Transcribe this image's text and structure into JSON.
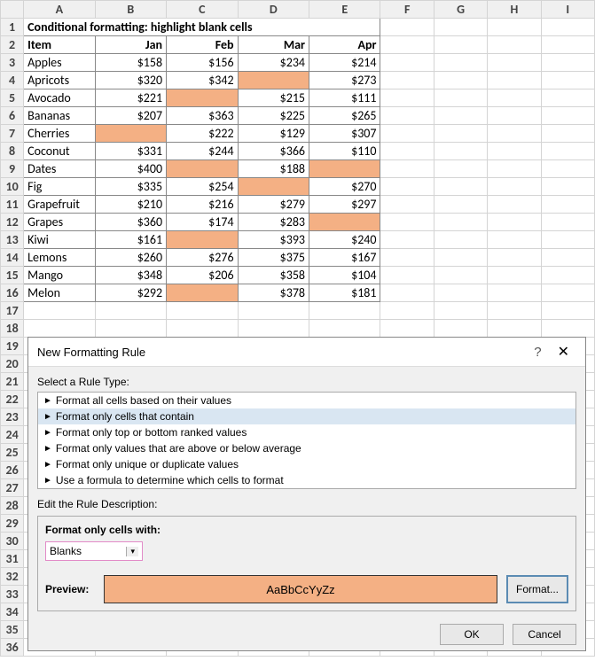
{
  "sheet": {
    "title": "Conditional formatting: highlight blank cells",
    "col_letters": [
      "A",
      "B",
      "C",
      "D",
      "E",
      "F",
      "G",
      "H",
      "I"
    ],
    "headers": [
      "Item",
      "Jan",
      "Feb",
      "Mar",
      "Apr"
    ],
    "rows": [
      {
        "item": "Apples",
        "vals": [
          "$158",
          "$156",
          "$234",
          "$214"
        ],
        "blanks": []
      },
      {
        "item": "Apricots",
        "vals": [
          "$320",
          "$342",
          "",
          "$273"
        ],
        "blanks": [
          2
        ]
      },
      {
        "item": "Avocado",
        "vals": [
          "$221",
          "",
          "$215",
          "$111"
        ],
        "blanks": [
          1
        ]
      },
      {
        "item": "Bananas",
        "vals": [
          "$207",
          "$363",
          "$225",
          "$265"
        ],
        "blanks": []
      },
      {
        "item": "Cherries",
        "vals": [
          "",
          "$222",
          "$129",
          "$307"
        ],
        "blanks": [
          0
        ]
      },
      {
        "item": "Coconut",
        "vals": [
          "$331",
          "$244",
          "$366",
          "$110"
        ],
        "blanks": []
      },
      {
        "item": "Dates",
        "vals": [
          "$400",
          "",
          "$188",
          ""
        ],
        "blanks": [
          1,
          3
        ]
      },
      {
        "item": "Fig",
        "vals": [
          "$335",
          "$254",
          "",
          "$270"
        ],
        "blanks": [
          2
        ]
      },
      {
        "item": "Grapefruit",
        "vals": [
          "$210",
          "$216",
          "$279",
          "$297"
        ],
        "blanks": []
      },
      {
        "item": "Grapes",
        "vals": [
          "$360",
          "$174",
          "$283",
          ""
        ],
        "blanks": [
          3
        ]
      },
      {
        "item": "Kiwi",
        "vals": [
          "$161",
          "",
          "$393",
          "$240"
        ],
        "blanks": [
          1
        ]
      },
      {
        "item": "Lemons",
        "vals": [
          "$260",
          "$276",
          "$375",
          "$167"
        ],
        "blanks": []
      },
      {
        "item": "Mango",
        "vals": [
          "$348",
          "$206",
          "$358",
          "$104"
        ],
        "blanks": []
      },
      {
        "item": "Melon",
        "vals": [
          "$292",
          "",
          "$378",
          "$181"
        ],
        "blanks": [
          1
        ]
      }
    ]
  },
  "dialog": {
    "title": "New Formatting Rule",
    "select_label": "Select a Rule Type:",
    "rule_types": [
      "Format all cells based on their values",
      "Format only cells that contain",
      "Format only top or bottom ranked values",
      "Format only values that are above or below average",
      "Format only unique or duplicate values",
      "Use a formula to determine which cells to format"
    ],
    "selected_rule_index": 1,
    "edit_label": "Edit the Rule Description:",
    "desc_header": "Format only cells with:",
    "dropdown_value": "Blanks",
    "preview_label": "Preview:",
    "preview_text": "AaBbCcYyZz",
    "format_btn": "Format...",
    "ok": "OK",
    "cancel": "Cancel"
  }
}
